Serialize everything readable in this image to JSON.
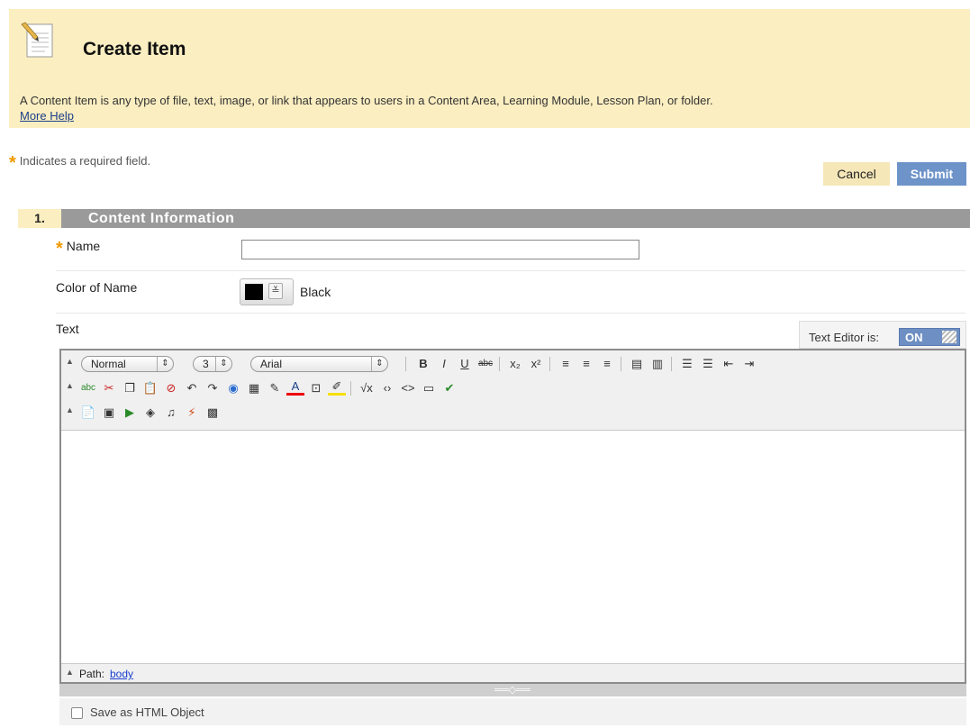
{
  "header": {
    "icon": "document-pencil-icon",
    "title": "Create Item",
    "description": "A Content Item is any type of file, text, image, or link that appears to users in a Content Area, Learning Module, Lesson Plan, or folder.",
    "help_link": "More Help"
  },
  "required_note": {
    "star": "*",
    "text": "Indicates a required field."
  },
  "actions": {
    "cancel": "Cancel",
    "submit": "Submit"
  },
  "section": {
    "number": "1.",
    "title": "Content Information"
  },
  "fields": {
    "name": {
      "star": "*",
      "label": "Name",
      "value": ""
    },
    "color": {
      "label": "Color of Name",
      "value": "Black",
      "swatch": "#000000"
    },
    "text": {
      "label": "Text"
    }
  },
  "editor": {
    "toggle_label": "Text Editor is:",
    "toggle_state": "ON",
    "format": "Normal",
    "size": "3",
    "font": "Arial",
    "path_label": "Path:",
    "path_value": "body",
    "resize_glyph": "══◇══"
  },
  "toolbar": {
    "row1": [
      {
        "name": "bold-icon",
        "glyph": "B"
      },
      {
        "name": "italic-icon",
        "glyph": "I"
      },
      {
        "name": "underline-icon",
        "glyph": "U"
      },
      {
        "name": "strikethrough-icon",
        "glyph": "abc"
      },
      {
        "name": "subscript-icon",
        "glyph": "x₂"
      },
      {
        "name": "superscript-icon",
        "glyph": "x²"
      },
      {
        "name": "align-left-icon",
        "glyph": "≡"
      },
      {
        "name": "align-center-icon",
        "glyph": "≡"
      },
      {
        "name": "align-right-icon",
        "glyph": "≡"
      },
      {
        "name": "copy-document-icon",
        "glyph": "▤"
      },
      {
        "name": "paste-document-icon",
        "glyph": "▥"
      },
      {
        "name": "numbered-list-icon",
        "glyph": "☰"
      },
      {
        "name": "bullet-list-icon",
        "glyph": "☰"
      },
      {
        "name": "outdent-icon",
        "glyph": "⇤"
      },
      {
        "name": "indent-icon",
        "glyph": "⇥"
      }
    ],
    "row2": [
      {
        "name": "spellcheck-icon",
        "glyph": "abc"
      },
      {
        "name": "cut-icon",
        "glyph": "✂"
      },
      {
        "name": "copy-icon",
        "glyph": "❐"
      },
      {
        "name": "paste-icon",
        "glyph": "📋"
      },
      {
        "name": "unlink-icon",
        "glyph": "⊘"
      },
      {
        "name": "undo-icon",
        "glyph": "↶"
      },
      {
        "name": "redo-icon",
        "glyph": "↷"
      },
      {
        "name": "link-globe-icon",
        "glyph": "◉"
      },
      {
        "name": "table-icon",
        "glyph": "▦"
      },
      {
        "name": "pencil-icon",
        "glyph": "✎"
      },
      {
        "name": "text-color-icon",
        "glyph": "A"
      },
      {
        "name": "embed-icon",
        "glyph": "⊡"
      },
      {
        "name": "highlight-icon",
        "glyph": "✐"
      },
      {
        "name": "math-icon",
        "glyph": "√x"
      },
      {
        "name": "html-view-icon",
        "glyph": "‹›"
      },
      {
        "name": "source-code-icon",
        "glyph": "<>"
      },
      {
        "name": "fullscreen-icon",
        "glyph": "▭"
      },
      {
        "name": "preview-icon",
        "glyph": "✔"
      }
    ],
    "row3": [
      {
        "name": "attach-file-icon",
        "glyph": "📄"
      },
      {
        "name": "insert-image-icon",
        "glyph": "▣"
      },
      {
        "name": "insert-media-icon",
        "glyph": "▶"
      },
      {
        "name": "insert-quicktime-icon",
        "glyph": "◈"
      },
      {
        "name": "insert-audio-icon",
        "glyph": "♫"
      },
      {
        "name": "insert-flash-icon",
        "glyph": "⚡"
      },
      {
        "name": "mashup-icon",
        "glyph": "▩"
      }
    ]
  },
  "options": {
    "html_object_label": "Save as HTML Object"
  },
  "colors": {
    "header_bg": "#fbeec1",
    "star": "#f09a00",
    "submit_bg": "#6d93c9",
    "section_bg": "#9a9a9a",
    "toggle_bg": "#6d8fc3"
  }
}
